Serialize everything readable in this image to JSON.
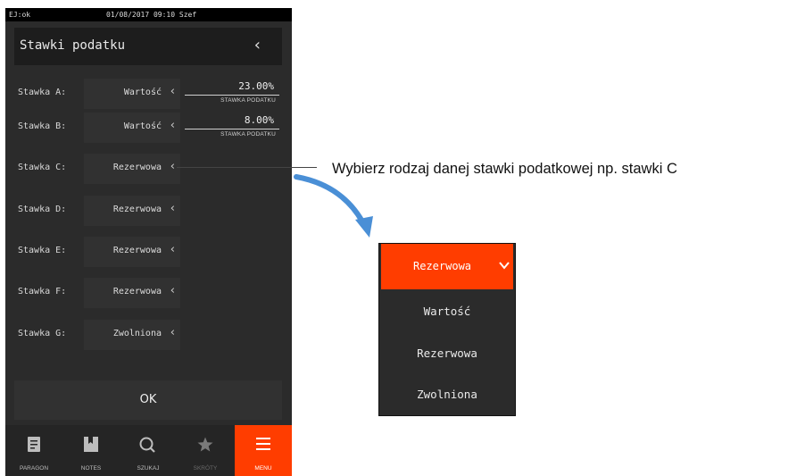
{
  "status_bar": {
    "left": "EJ:ok",
    "center": "01/08/2017 09:10 Szef"
  },
  "header": {
    "title": "Stawki podatku"
  },
  "rates": [
    {
      "label": "Stawka A:",
      "type": "Wartość",
      "value": "23.00%",
      "caption": "STAWKA PODATKU"
    },
    {
      "label": "Stawka B:",
      "type": "Wartość",
      "value": "8.00%",
      "caption": "STAWKA PODATKU"
    },
    {
      "label": "Stawka C:",
      "type": "Rezerwowa"
    },
    {
      "label": "Stawka D:",
      "type": "Rezerwowa"
    },
    {
      "label": "Stawka E:",
      "type": "Rezerwowa"
    },
    {
      "label": "Stawka F:",
      "type": "Rezerwowa"
    },
    {
      "label": "Stawka G:",
      "type": "Zwolniona"
    }
  ],
  "ok_button": {
    "label": "OK"
  },
  "navbar": {
    "items": [
      {
        "label": "PARAGON",
        "icon": "receipt-icon"
      },
      {
        "label": "NOTES",
        "icon": "notes-icon"
      },
      {
        "label": "SZUKAJ",
        "icon": "search-icon"
      },
      {
        "label": "SKRÓTY",
        "icon": "star-icon",
        "disabled": true
      },
      {
        "label": "MENU",
        "icon": "menu-icon",
        "active": true
      }
    ]
  },
  "annotation": {
    "text": "Wybierz rodzaj danej stawki podatkowej np. stawki C"
  },
  "dropdown": {
    "selected": "Rezerwowa",
    "options": [
      "Wartość",
      "Rezerwowa",
      "Zwolniona"
    ]
  },
  "colors": {
    "accent": "#ff3d00",
    "background": "#2b2b2b",
    "control": "#313131"
  }
}
